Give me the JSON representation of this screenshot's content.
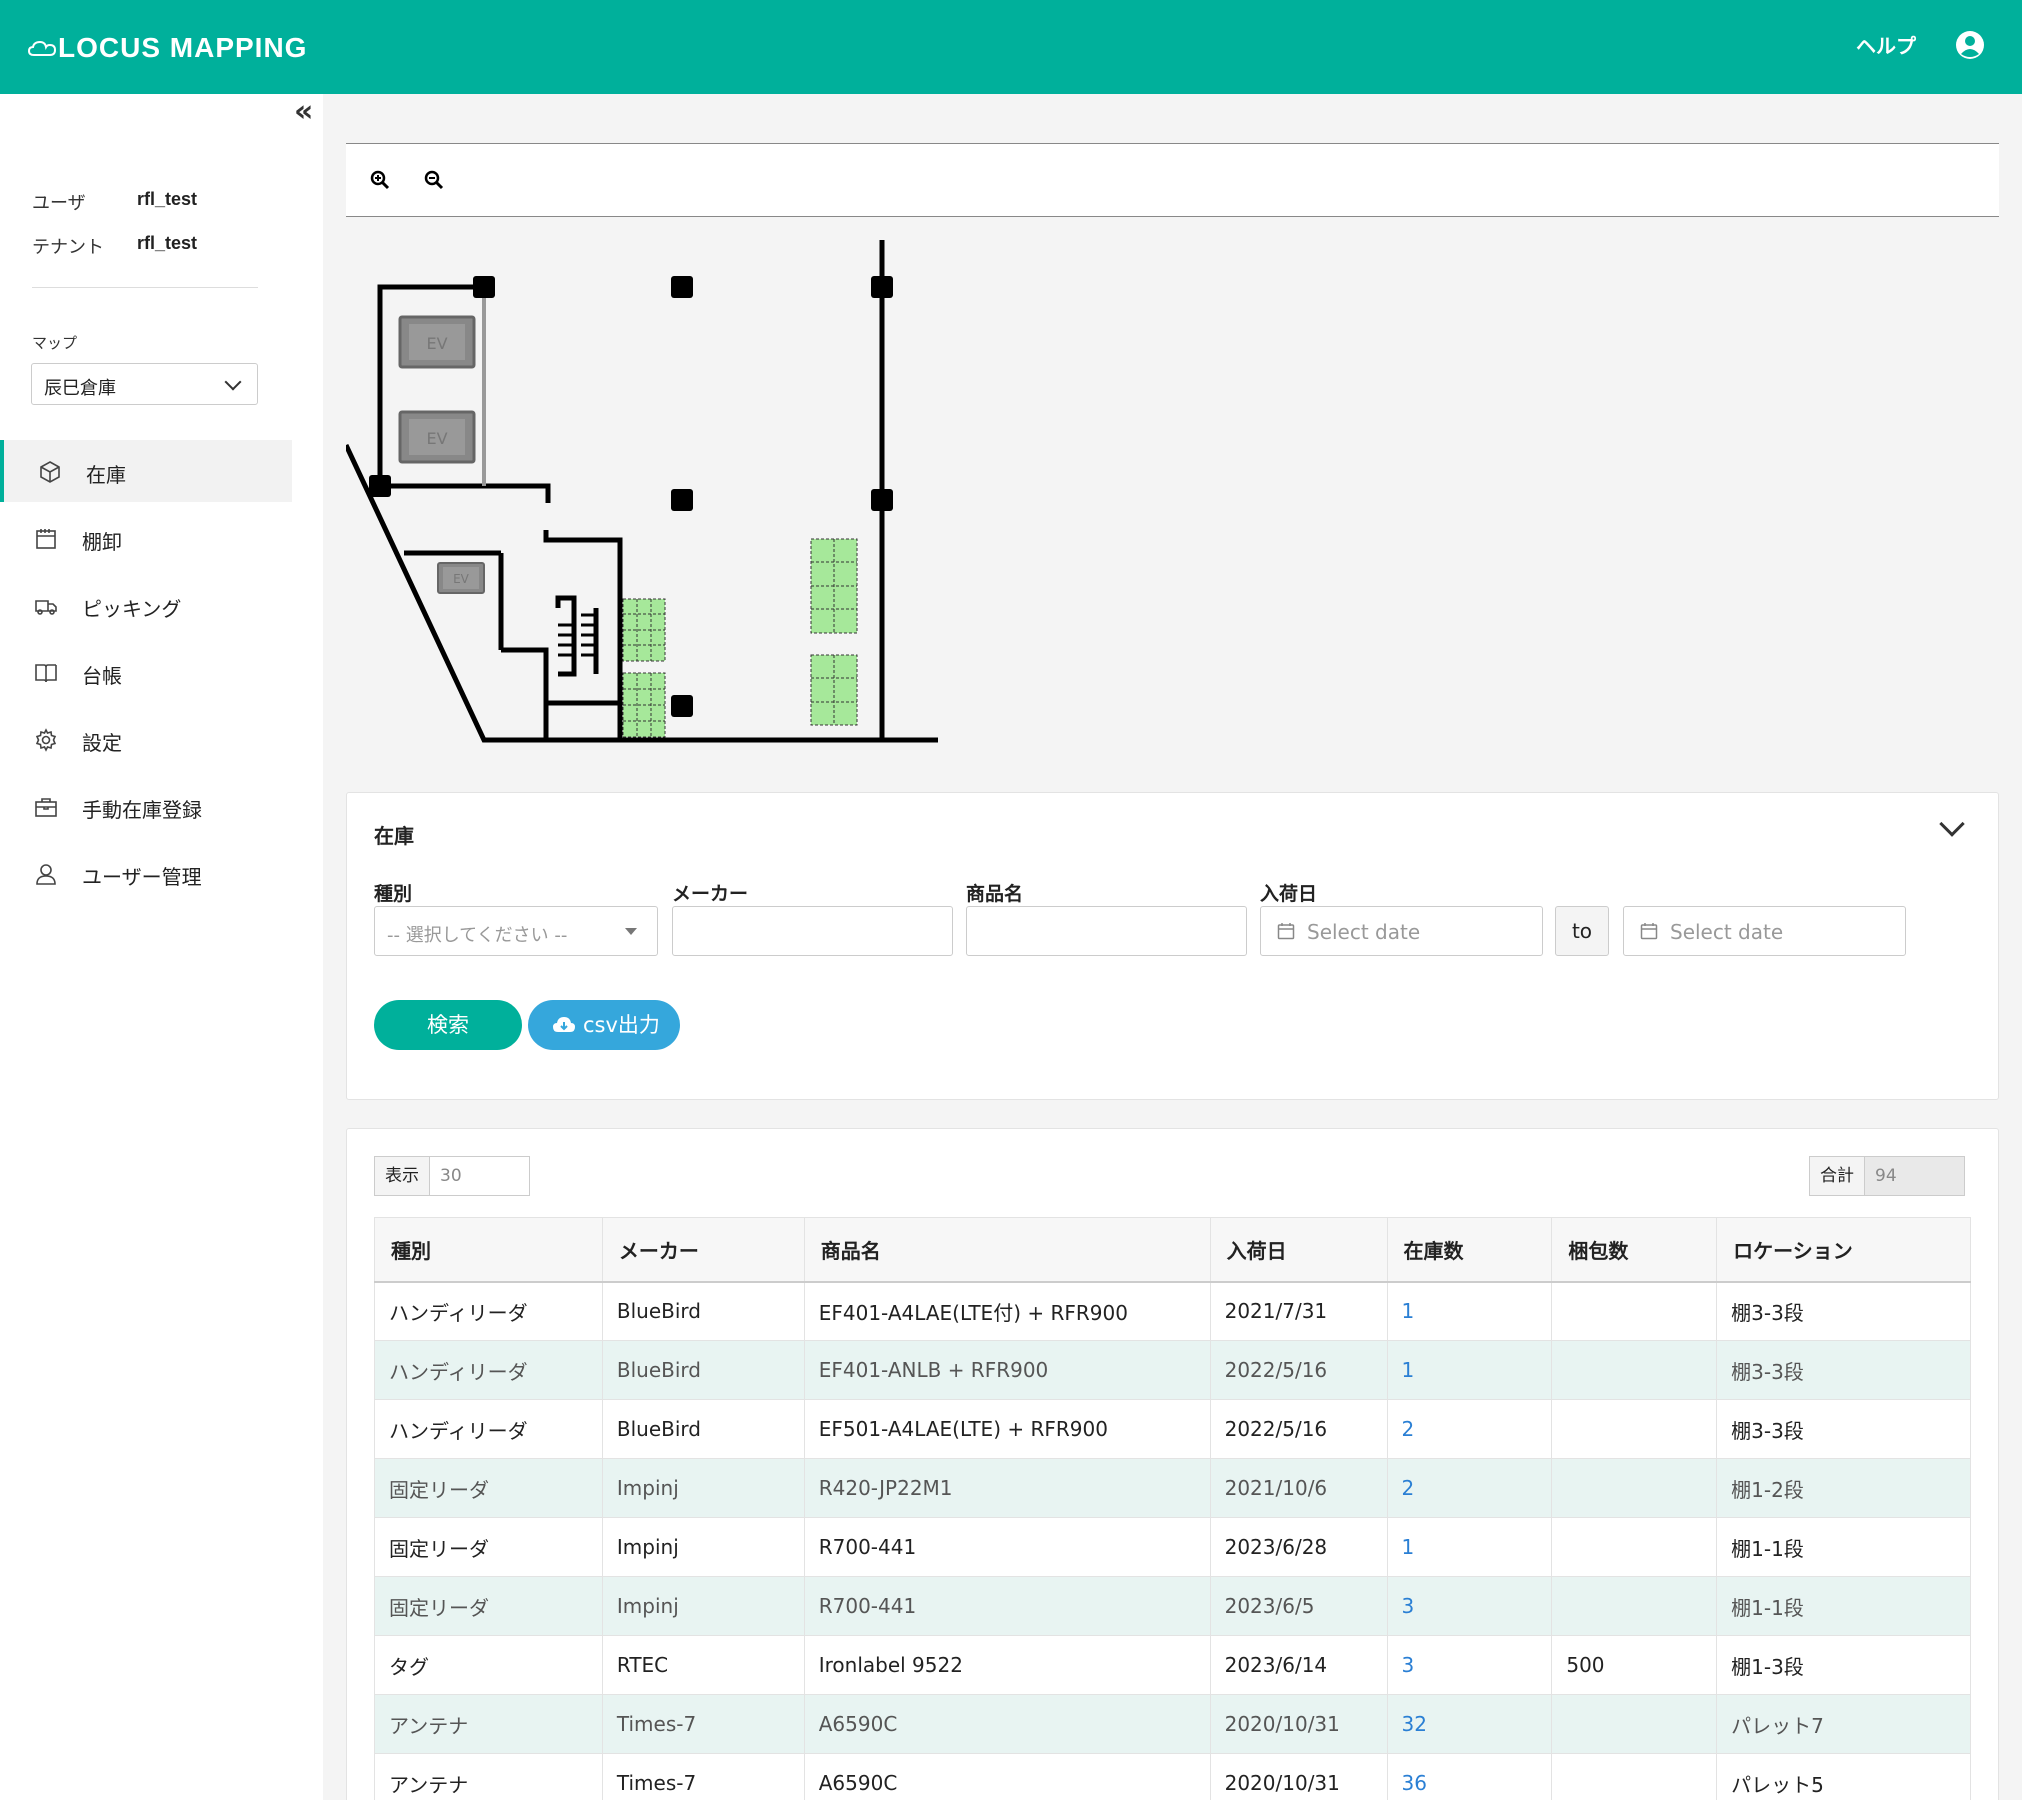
{
  "header": {
    "logo": "LOCUS MAPPING",
    "help": "ヘルプ"
  },
  "sidebar": {
    "user_label": "ユーザ",
    "user_value": "rfl_test",
    "tenant_label": "テナント",
    "tenant_value": "rfl_test",
    "map_label": "マップ",
    "map_value": "辰巳倉庫",
    "items": [
      {
        "label": "在庫",
        "icon": "box-icon",
        "active": true
      },
      {
        "label": "棚卸",
        "icon": "calendar-icon",
        "active": false
      },
      {
        "label": "ピッキング",
        "icon": "truck-icon",
        "active": false
      },
      {
        "label": "台帳",
        "icon": "book-icon",
        "active": false
      },
      {
        "label": "設定",
        "icon": "gear-icon",
        "active": false
      },
      {
        "label": "手動在庫登録",
        "icon": "briefcase-icon",
        "active": false
      },
      {
        "label": "ユーザー管理",
        "icon": "user-icon",
        "active": false
      }
    ]
  },
  "map": {
    "elevator_label": "EV"
  },
  "search": {
    "title": "在庫",
    "type_label": "種別",
    "type_placeholder": "-- 選択してください --",
    "maker_label": "メーカー",
    "product_label": "商品名",
    "date_label": "入荷日",
    "date_from_placeholder": "Select date",
    "date_to_text": "to",
    "date_to_placeholder": "Select date",
    "search_button": "検索",
    "csv_button": "csv出力"
  },
  "table": {
    "display_label": "表示",
    "display_value": "30",
    "total_label": "合計",
    "total_value": "94",
    "columns": [
      "種別",
      "メーカー",
      "商品名",
      "入荷日",
      "在庫数",
      "梱包数",
      "ロケーション"
    ],
    "rows": [
      [
        "ハンディリーダ",
        "BlueBird",
        "EF401-A4LAE(LTE付) + RFR900",
        "2021/7/31",
        "1",
        "",
        "棚3-3段"
      ],
      [
        "ハンディリーダ",
        "BlueBird",
        "EF401-ANLB + RFR900",
        "2022/5/16",
        "1",
        "",
        "棚3-3段"
      ],
      [
        "ハンディリーダ",
        "BlueBird",
        "EF501-A4LAE(LTE) + RFR900",
        "2022/5/16",
        "2",
        "",
        "棚3-3段"
      ],
      [
        "固定リーダ",
        "Impinj",
        "R420-JP22M1",
        "2021/10/6",
        "2",
        "",
        "棚1-2段"
      ],
      [
        "固定リーダ",
        "Impinj",
        "R700-441",
        "2023/6/28",
        "1",
        "",
        "棚1-1段"
      ],
      [
        "固定リーダ",
        "Impinj",
        "R700-441",
        "2023/6/5",
        "3",
        "",
        "棚1-1段"
      ],
      [
        "タグ",
        "RTEC",
        "Ironlabel 9522",
        "2023/6/14",
        "3",
        "500",
        "棚1-3段"
      ],
      [
        "アンテナ",
        "Times-7",
        "A6590C",
        "2020/10/31",
        "32",
        "",
        "パレット7"
      ],
      [
        "アンテナ",
        "Times-7",
        "A6590C",
        "2020/10/31",
        "36",
        "",
        "パレット5"
      ]
    ]
  },
  "colors": {
    "brand": "#00b09b",
    "csv": "#35a7dc",
    "link": "#2a7fd4",
    "alt_row": "#e8f4f2",
    "shelf": "#a6e89a"
  }
}
